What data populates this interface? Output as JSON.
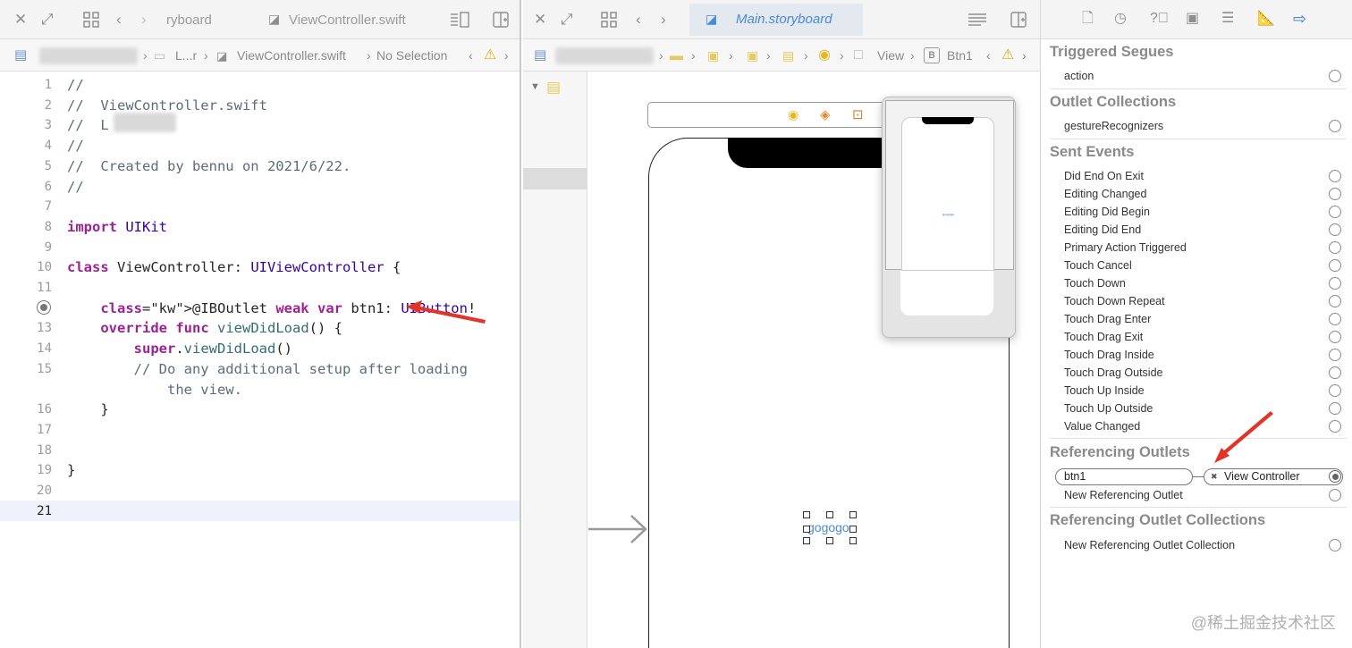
{
  "left_editor": {
    "tabs": [
      {
        "label": "ryboard",
        "active": false
      },
      {
        "label": "ViewController.swift",
        "active": false
      }
    ],
    "jumpbar": {
      "crumb_folder": "L...r",
      "crumb_file": "ViewController.swift",
      "crumb_selection": "No Selection"
    },
    "code_lines": [
      {
        "num": "1",
        "text": "//"
      },
      {
        "num": "2",
        "text": "//  ViewController.swift"
      },
      {
        "num": "3",
        "text": "//  L"
      },
      {
        "num": "4",
        "text": "//"
      },
      {
        "num": "5",
        "text": "//  Created by bennu on 2021/6/22."
      },
      {
        "num": "6",
        "text": "//"
      },
      {
        "num": "7",
        "text": ""
      },
      {
        "num": "8",
        "text": "import UIKit"
      },
      {
        "num": "9",
        "text": ""
      },
      {
        "num": "10",
        "text": "class ViewController: UIViewController {"
      },
      {
        "num": "11",
        "text": ""
      },
      {
        "num": "12",
        "text": "    @IBOutlet weak var btn1: UIButton!"
      },
      {
        "num": "13",
        "text": "    override func viewDidLoad() {"
      },
      {
        "num": "14",
        "text": "        super.viewDidLoad()"
      },
      {
        "num": "15",
        "text": "        // Do any additional setup after loading"
      },
      {
        "num": "",
        "text": "            the view."
      },
      {
        "num": "16",
        "text": "    }"
      },
      {
        "num": "17",
        "text": ""
      },
      {
        "num": "18",
        "text": ""
      },
      {
        "num": "19",
        "text": "}"
      },
      {
        "num": "20",
        "text": ""
      },
      {
        "num": "21",
        "text": ""
      }
    ]
  },
  "middle_editor": {
    "tab_title": "Main.storyboard",
    "jumpbar": {
      "crumb_view": "View",
      "crumb_badge": "B",
      "crumb_button": "Btn1"
    },
    "canvas": {
      "button_label": "gogogo"
    }
  },
  "inspector": {
    "sections": {
      "triggered_segues": "Triggered Segues",
      "outlet_collections": "Outlet Collections",
      "sent_events": "Sent Events",
      "referencing_outlets": "Referencing Outlets",
      "referencing_outlet_collections": "Referencing Outlet Collections"
    },
    "triggered_segues": [
      "action"
    ],
    "outlet_collections": [
      "gestureRecognizers"
    ],
    "sent_events": [
      "Did End On Exit",
      "Editing Changed",
      "Editing Did Begin",
      "Editing Did End",
      "Primary Action Triggered",
      "Touch Cancel",
      "Touch Down",
      "Touch Down Repeat",
      "Touch Drag Enter",
      "Touch Drag Exit",
      "Touch Drag Inside",
      "Touch Drag Outside",
      "Touch Up Inside",
      "Touch Up Outside",
      "Value Changed"
    ],
    "referencing_outlet": {
      "outlet": "btn1",
      "target": "View Controller",
      "new_label": "New Referencing Outlet"
    },
    "new_outlet_collection": "New Referencing Outlet Collection"
  },
  "watermark": "@稀土掘金技术社区",
  "colors": {
    "annotation_arrow": "#e0362a",
    "swift_keyword": "#9b2393",
    "swift_type": "#3900a0",
    "swift_comment": "#5d6c79",
    "storyboard_accent": "#4a8ad8"
  }
}
